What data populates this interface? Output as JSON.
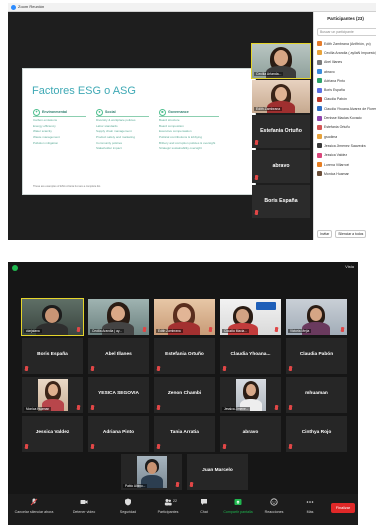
{
  "top_window": {
    "title": "Zoom Reunión",
    "slide": {
      "title": "Factores ESG o ASG",
      "columns": [
        {
          "label": "Environmental",
          "items": [
            "Carbon emissions",
            "Energy efficiency",
            "Water scarcity",
            "Waste management",
            "Pollution mitigation"
          ]
        },
        {
          "label": "Social",
          "items": [
            "Diversity & workplace policies",
            "Labor standards",
            "Supply chain management",
            "Product safety and marketing",
            "Community policies",
            "Stakeholder impact"
          ]
        },
        {
          "label": "Governance",
          "items": [
            "Board structure",
            "Board composition",
            "Executive compensation",
            "Political contributions & lobbying",
            "Bribery and corruption policies & oversight",
            "Strategic sustainability oversight"
          ]
        }
      ],
      "footer": "These are examples of ESG criteria but are a complete list."
    },
    "video_tiles": [
      {
        "label": "Cecilia Arlanda..."
      },
      {
        "label": "Edith Zambrana"
      },
      {
        "name": "Estefania Ortuño"
      },
      {
        "name": "abravo"
      },
      {
        "name": "Boris España"
      }
    ],
    "participants_panel": {
      "title": "Participantes (23)",
      "search_placeholder": "Buscar un participante",
      "participants": [
        {
          "name": "Edith Zambrana (Anfitrión, yo)",
          "color": "#e57c2b"
        },
        {
          "name": "Cecilia Arandia ( ayllaN Impuesto)",
          "color": "#e8a33a"
        },
        {
          "name": "Abel Illanes",
          "color": "#7a7a7a"
        },
        {
          "name": "abravo",
          "color": "#3a8ddb"
        },
        {
          "name": "Adriana Pinto",
          "color": "#2ba36b"
        },
        {
          "name": "Boris España",
          "color": "#5b6ee1"
        },
        {
          "name": "Claudia Pabón",
          "color": "#c0392b"
        },
        {
          "name": "Claudia Yhoana Alvarez de Flores",
          "color": "#2d6cc4"
        },
        {
          "name": "Denisse Macias Kovacic",
          "color": "#8e44ad"
        },
        {
          "name": "Estefania Ortuño",
          "color": "#d35454"
        },
        {
          "name": "gsodima",
          "color": "#e6a23c"
        },
        {
          "name": "Jessica Jimenez Saavedra",
          "color": "#3a3a3a"
        },
        {
          "name": "Jessica Valdez",
          "color": "#d9467b"
        },
        {
          "name": "Lorena Villarroel",
          "color": "#e67e22"
        },
        {
          "name": "Monica Huaman",
          "color": "#6b4f3a"
        }
      ],
      "invite_label": "Invitar",
      "mute_all_label": "Silenciar a todos"
    }
  },
  "bottom_window": {
    "view_label": "Vista",
    "tiles": [
      {
        "label": "clarjalana",
        "kind": "photo"
      },
      {
        "label": "Cecilia Arandia ( ay...",
        "kind": "photo"
      },
      {
        "label": "Edith Zambrana",
        "kind": "photo"
      },
      {
        "label": "Claudia Macia...",
        "kind": "photo"
      },
      {
        "label": "Victoria Mejía",
        "kind": "photo"
      },
      {
        "name": "Boris España"
      },
      {
        "name": "Abel Illanes"
      },
      {
        "name": "Estefania Ortuño"
      },
      {
        "name": "Claudia Yhoana..."
      },
      {
        "name": "Claudia Pabón"
      },
      {
        "label": "Monica Huaman",
        "kind": "photo"
      },
      {
        "name": "YESICA SEGOVIA"
      },
      {
        "name": "Zenon Chambi"
      },
      {
        "label": "Jessica Jimene...",
        "kind": "photo"
      },
      {
        "name": "mhuaman"
      },
      {
        "name": "Jessica Valdez"
      },
      {
        "name": "Adriana Pinto"
      },
      {
        "name": "Tania Arratia"
      },
      {
        "name": "abravo"
      },
      {
        "name": "Cinthya Rojo"
      },
      {
        "label": "Pablo Albino...",
        "kind": "photo"
      },
      {
        "name": "Juan Marcelo"
      }
    ],
    "toolbar": {
      "mute": "Cancelar silenciar ahora",
      "video": "Detener video",
      "security": "Seguridad",
      "participants": "Participantes",
      "participants_count": "22",
      "chat": "Chat",
      "share": "Compartir pantalla",
      "reactions": "Reacciones",
      "more": "Más",
      "end": "Finalizar"
    }
  }
}
